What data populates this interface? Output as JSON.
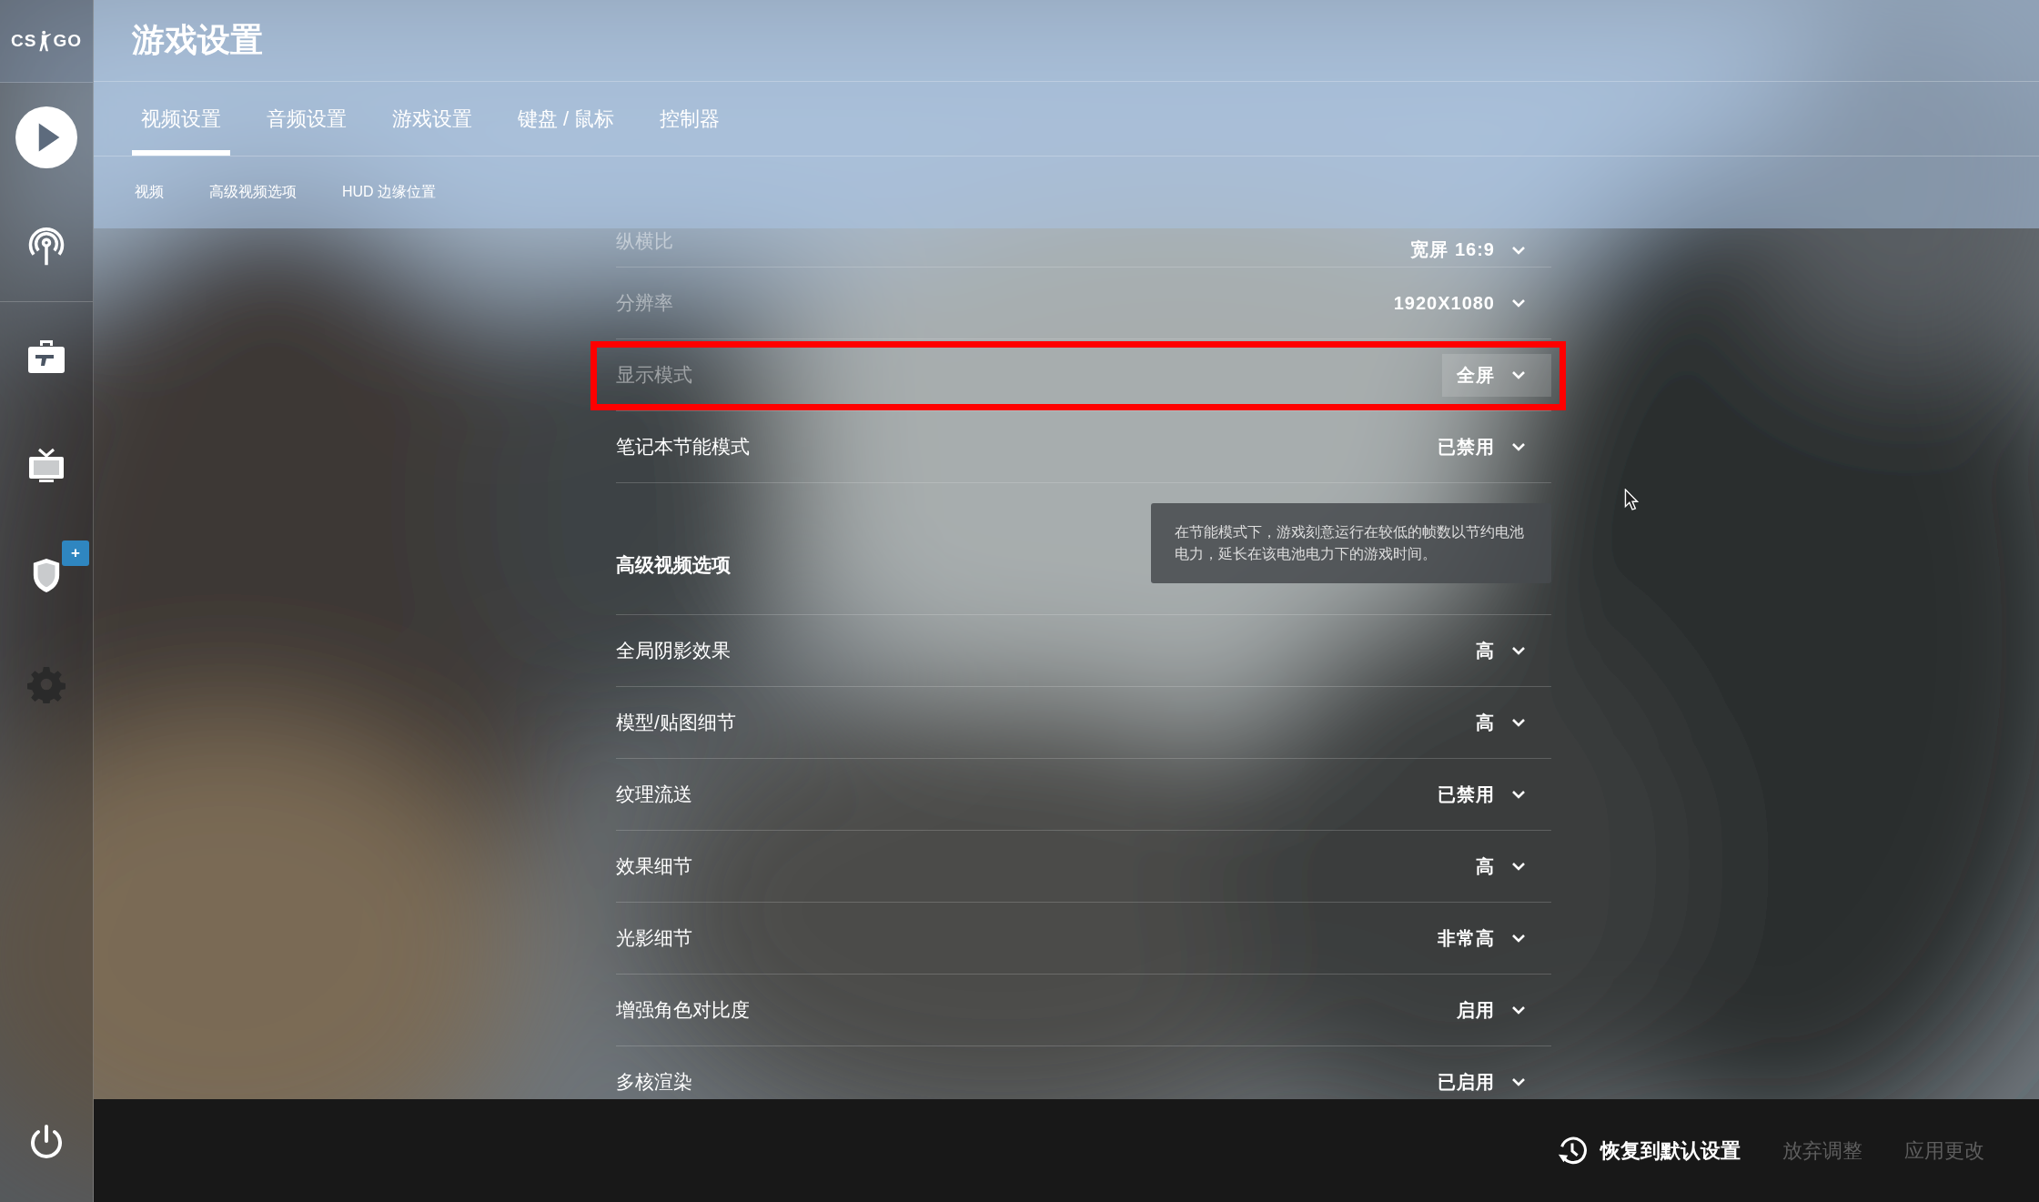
{
  "logo": {
    "left": "CS",
    "right": "GO"
  },
  "sidebar": {
    "items": [
      {
        "kind": "play",
        "selected": false
      },
      {
        "kind": "antenna",
        "selected": false
      },
      {
        "kind": "briefcase",
        "selected": false
      },
      {
        "kind": "tv",
        "selected": false
      },
      {
        "kind": "shield",
        "selected": false,
        "badge": "+"
      },
      {
        "kind": "gear",
        "selected": true
      }
    ],
    "power": {
      "kind": "power"
    }
  },
  "header": {
    "title": "游戏设置"
  },
  "tabs": [
    {
      "label": "视频设置",
      "selected": true
    },
    {
      "label": "音频设置",
      "selected": false
    },
    {
      "label": "游戏设置",
      "selected": false
    },
    {
      "label": "键盘 / 鼠标",
      "selected": false
    },
    {
      "label": "控制器",
      "selected": false
    }
  ],
  "subtabs": [
    {
      "label": "视频"
    },
    {
      "label": "高级视频选项"
    },
    {
      "label": "HUD 边缘位置"
    }
  ],
  "sections": [
    {
      "rows": [
        {
          "label": "纵横比",
          "value": "宽屏 16:9",
          "disabled": true,
          "highlighted": false
        },
        {
          "label": "分辨率",
          "value": "1920X1080",
          "disabled": true,
          "highlighted": false
        },
        {
          "label": "显示模式",
          "value": "全屏",
          "disabled": true,
          "highlighted": true
        },
        {
          "label": "笔记本节能模式",
          "value": "已禁用",
          "disabled": false,
          "highlighted": false
        }
      ]
    },
    {
      "title": "高级视频选项",
      "tooltip": "在节能模式下，游戏刻意运行在较低的帧数以节约电池电力，延长在该电池电力下的游戏时间。",
      "rows": [
        {
          "label": "全局阴影效果",
          "value": "高",
          "disabled": false,
          "highlighted": false
        },
        {
          "label": "模型/贴图细节",
          "value": "高",
          "disabled": false,
          "highlighted": false
        },
        {
          "label": "纹理流送",
          "value": "已禁用",
          "disabled": false,
          "highlighted": false
        },
        {
          "label": "效果细节",
          "value": "高",
          "disabled": false,
          "highlighted": false
        },
        {
          "label": "光影细节",
          "value": "非常高",
          "disabled": false,
          "highlighted": false
        },
        {
          "label": "增强角色对比度",
          "value": "启用",
          "disabled": false,
          "highlighted": false
        },
        {
          "label": "多核渲染",
          "value": "已启用",
          "disabled": false,
          "highlighted": false
        }
      ]
    }
  ],
  "footer": {
    "buttons": [
      {
        "label": "恢复到默认设置",
        "disabled": false,
        "kind": "with-icon"
      },
      {
        "label": "放弃调整",
        "disabled": true,
        "kind": "plain"
      },
      {
        "label": "应用更改",
        "disabled": true,
        "kind": "plain"
      }
    ]
  }
}
